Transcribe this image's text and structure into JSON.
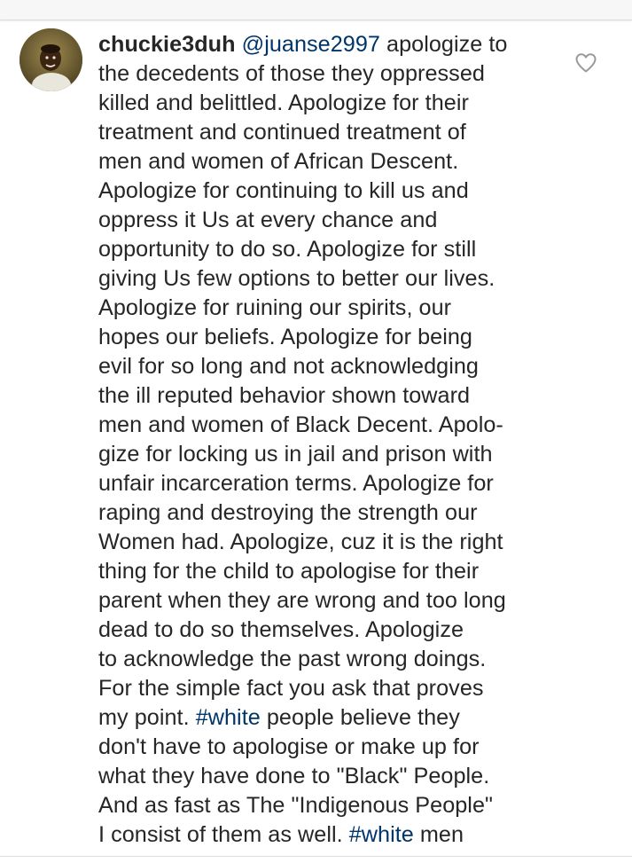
{
  "comment": {
    "username": "chuckie3duh",
    "mention": "@juanse2997",
    "lines": [
      " apologize to",
      "the decedents of those they oppressed",
      "killed and belittled. Apologize for their",
      "treatment and continued treatment of",
      "men and women of African Descent.",
      "Apologize for continuing to kill us and",
      "oppress it Us at every chance and",
      "opportunity to do so. Apologize for still",
      "giving Us few options to better our lives.",
      "Apologize for ruining our spirits, our",
      "hopes our beliefs. Apologize for being",
      "evil for so long and not acknowledging",
      "the ill reputed behavior shown toward",
      "men and women of Black Decent. Apolo-",
      "gize for locking us in jail and prison with",
      "unfair incarceration terms. Apologize for",
      "raping and destroying the strength our",
      "Women had. Apologize, cuz it is the right",
      "thing for the child to apologise for their",
      "parent when they are wrong and too long",
      "dead to do so themselves. Apologize",
      "to acknowledge the past wrong doings.",
      "For the simple fact you ask that proves"
    ],
    "line24_before": "my point. ",
    "hashtag_1": "#white",
    "line24_after": " people believe they",
    "lines_b": [
      "don't have to apologise or make up for",
      "what they have done to \"Black\" People.",
      "And as fast as The \"Indigenous People\""
    ],
    "line28_before": "I consist of them as well. ",
    "hashtag_2": "#white",
    "line28_after": " men"
  },
  "icons": {
    "like": "heart-outline-icon",
    "avatar": "user-avatar-photo"
  },
  "colors": {
    "text": "#262626",
    "link": "#003569",
    "icon": "#999999",
    "background": "#ffffff"
  }
}
